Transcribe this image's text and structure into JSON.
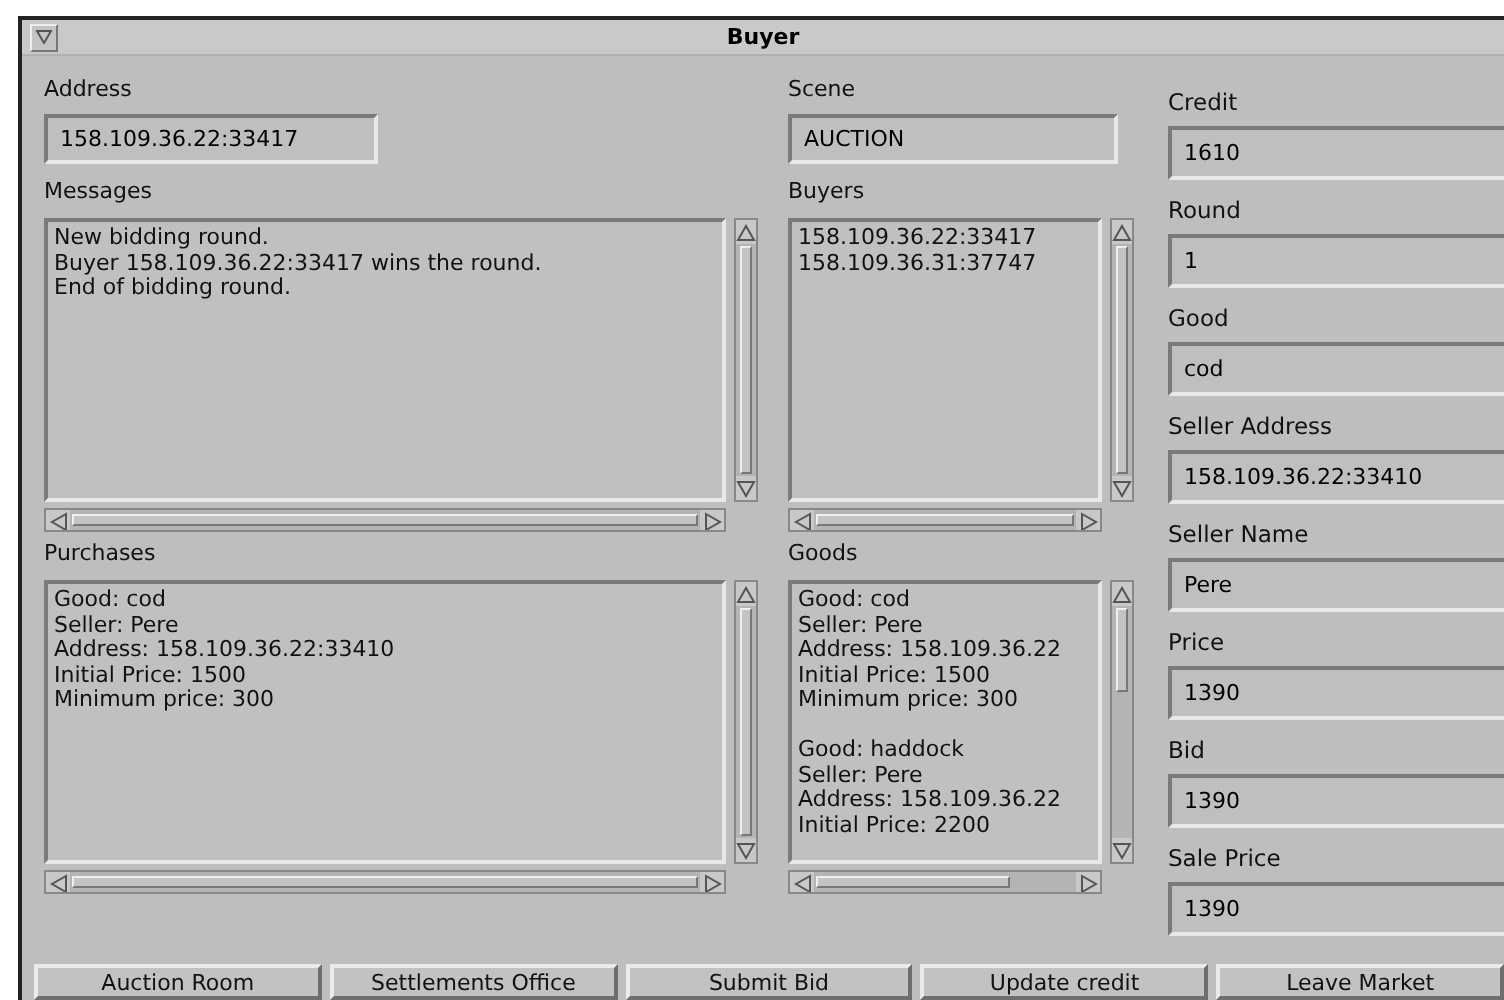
{
  "window": {
    "title": "Buyer"
  },
  "fields": [
    {
      "label": "Address",
      "value": "158.109.36.22:33417"
    },
    {
      "label": "Scene",
      "value": "AUCTION"
    }
  ],
  "lists": [
    {
      "label": "Messages",
      "entries": [
        [
          "New bidding round.",
          "Buyer 158.109.36.22:33417 wins the round.",
          "End of bidding round."
        ]
      ]
    },
    {
      "label": "Buyers",
      "entries": [
        [
          "158.109.36.22:33417",
          "158.109.36.31:37747"
        ]
      ]
    },
    {
      "label": "Purchases",
      "entries": [
        [
          "Good: cod",
          "Seller: Pere",
          "Address: 158.109.36.22:33410",
          "Initial Price: 1500",
          "Minimum price: 300"
        ]
      ]
    },
    {
      "label": "Goods",
      "entries": [
        [
          "Good: cod",
          "Seller: Pere",
          "Address: 158.109.36.22",
          "Initial Price: 1500",
          "Minimum price: 300"
        ],
        [
          "Good: haddock",
          "Seller: Pere",
          "Address: 158.109.36.22",
          "Initial Price: 2200"
        ]
      ]
    }
  ],
  "details": [
    {
      "label": "Credit",
      "value": "1610"
    },
    {
      "label": "Round",
      "value": "1"
    },
    {
      "label": "Good",
      "value": "cod"
    },
    {
      "label": "Seller Address",
      "value": "158.109.36.22:33410"
    },
    {
      "label": "Seller Name",
      "value": "Pere"
    },
    {
      "label": "Price",
      "value": "1390"
    },
    {
      "label": "Bid",
      "value": "1390"
    },
    {
      "label": "Sale Price",
      "value": "1390"
    }
  ],
  "buttons": [
    "Auction Room",
    "Settlements Office",
    "Submit Bid",
    "Update credit",
    "Leave Market"
  ]
}
